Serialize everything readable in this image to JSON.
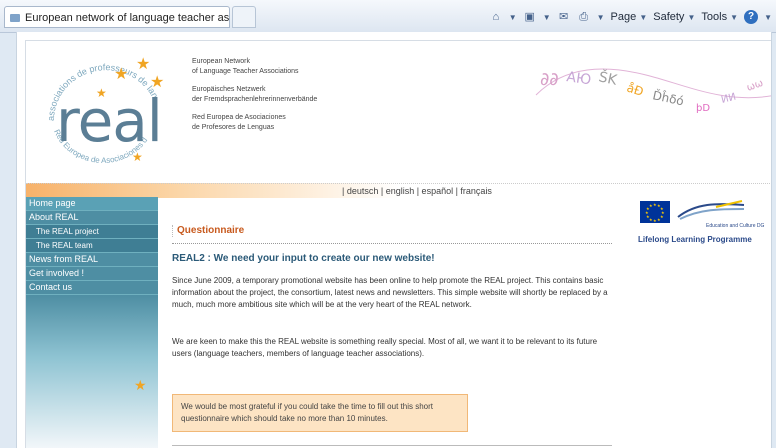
{
  "browser": {
    "tab_title": "European network of language teacher associatio...",
    "toolbar": {
      "page_label": "Page",
      "safety_label": "Safety",
      "tools_label": "Tools"
    }
  },
  "header": {
    "logo_text": "real",
    "logo_ring_text": "associations de professeurs de langues",
    "logo_ring_text2": "Red Europea de Asociaciones de Profesores de Lenguas",
    "org_en_line1": "European Network",
    "org_en_line2": "of Language Teacher Associations",
    "org_de_line1": "Europäisches Netzwerk",
    "org_de_line2": "der Fremdsprachenlehrerinnenverbände",
    "org_es_line1": "Red Europea de Asociaciones",
    "org_es_line2": "de Profesores de Lenguas",
    "decorative_text": "AЮŠKåĐĎĥδόω..."
  },
  "language_bar": {
    "text": "| deutsch | english | español | français"
  },
  "nav": {
    "items": [
      {
        "label": "Home page"
      },
      {
        "label": "About REAL"
      },
      {
        "label": "The REAL project"
      },
      {
        "label": "The REAL team"
      },
      {
        "label": "News from REAL"
      },
      {
        "label": "Get involved !"
      },
      {
        "label": "Contact us"
      }
    ]
  },
  "main": {
    "section_title": "Questionnaire",
    "heading": "REAL2 : We need your input to create our new website!",
    "paragraph1": "Since June 2009, a temporary promotional website has been online to help promote the REAL project. This contains basic information about the project, the consortium, latest news and newsletters. This simple website will shortly be replaced by a much, much more ambitious site which will be at the very heart of the REAL network.",
    "paragraph2": "We are keen to make this the REAL website is something really special. Most of all, we want it to be relevant to its future users (language teachers, members of language teacher associations).",
    "callout": "We would be most grateful if you could take the time to fill out this short questionnaire which should take no more than 10 minutes."
  },
  "sidebar_right": {
    "edu_label": "Education and Culture DG",
    "programme_label": "Lifelong Learning Programme"
  },
  "colors": {
    "accent_orange": "#f0a524",
    "nav_teal": "#4e8ea3",
    "heading_blue": "#2b5a78",
    "callout_bg": "#fde4c4"
  }
}
